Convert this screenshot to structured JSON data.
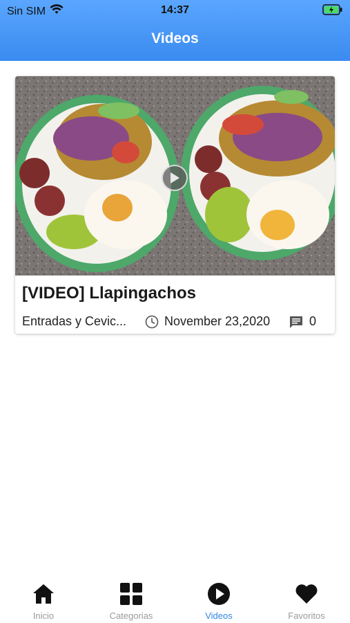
{
  "status_bar": {
    "carrier": "Sin SIM",
    "time": "14:37",
    "battery_color": "#4cd964"
  },
  "header": {
    "title": "Videos",
    "gradient_top": "#5aa6ff",
    "gradient_bottom": "#3a8bf0"
  },
  "video_card": {
    "title": "[VIDEO] Llapingachos",
    "category": "Entradas y Cevic...",
    "date": "November 23,2020",
    "comments": "0",
    "thumbnail_alt": "Two plates of llapingachos with sausage, avocado, fried egg and onion salad"
  },
  "tabs": [
    {
      "label": "Inicio",
      "icon": "home-icon",
      "active": false
    },
    {
      "label": "Categorias",
      "icon": "grid-icon",
      "active": false
    },
    {
      "label": "Videos",
      "icon": "play-circle-icon",
      "active": true
    },
    {
      "label": "Favoritos",
      "icon": "heart-icon",
      "active": false
    }
  ],
  "colors": {
    "accent": "#2f86e6",
    "tab_inactive": "#9a9a9a"
  }
}
